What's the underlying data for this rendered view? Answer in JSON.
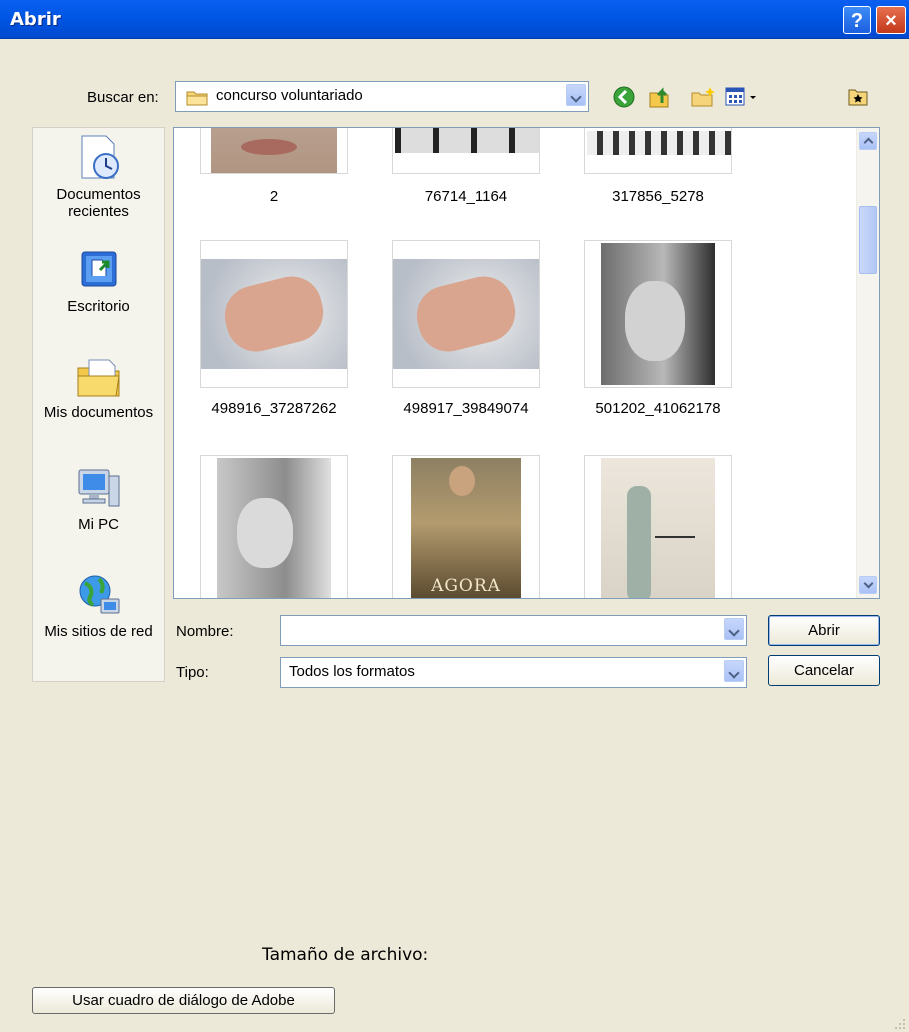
{
  "window": {
    "title": "Abrir",
    "help_button": "?",
    "close_button": "×"
  },
  "lookin": {
    "label": "Buscar en:",
    "value": "concurso voluntariado"
  },
  "places": [
    {
      "label": "Documentos recientes",
      "icon": "recent-documents-icon"
    },
    {
      "label": "Escritorio",
      "icon": "desktop-icon"
    },
    {
      "label": "Mis documentos",
      "icon": "my-documents-icon"
    },
    {
      "label": "Mi PC",
      "icon": "my-computer-icon"
    },
    {
      "label": "Mis sitios de red",
      "icon": "network-places-icon"
    }
  ],
  "files": [
    {
      "name": "2"
    },
    {
      "name": "76714_1164"
    },
    {
      "name": "317856_5278"
    },
    {
      "name": "498916_37287262"
    },
    {
      "name": "498917_39849074"
    },
    {
      "name": "501202_41062178"
    },
    {
      "name": ""
    },
    {
      "name": ""
    },
    {
      "name": ""
    }
  ],
  "poster_text": "AGORA",
  "filename": {
    "label": "Nombre:",
    "value": ""
  },
  "filetype": {
    "label": "Tipo:",
    "value": "Todos los formatos"
  },
  "buttons": {
    "open": "Abrir",
    "cancel": "Cancelar",
    "adobe": "Usar cuadro de diálogo de Adobe"
  },
  "file_size_label": "Tamaño de archivo:",
  "colors": {
    "titlebar": "#0058e6",
    "dialog_bg": "#ece9d8",
    "border": "#7f9db9"
  }
}
